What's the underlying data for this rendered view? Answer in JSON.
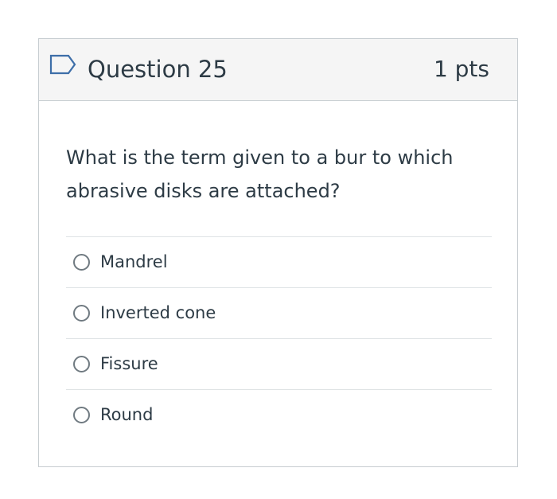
{
  "question": {
    "title": "Question 25",
    "points": "1 pts",
    "flag_icon": "flag-outline-icon",
    "text": "What is the term given to a bur to which abrasive disks are attached?",
    "answers": [
      {
        "label": "Mandrel",
        "selected": false
      },
      {
        "label": "Inverted cone",
        "selected": false
      },
      {
        "label": "Fissure",
        "selected": false
      },
      {
        "label": "Round",
        "selected": false
      }
    ]
  },
  "colors": {
    "header_background": "#f5f5f5",
    "border": "#c7cdd1",
    "text": "#2d3b45",
    "flag_accent": "#3d6ea8",
    "radio_border": "#707a81"
  }
}
